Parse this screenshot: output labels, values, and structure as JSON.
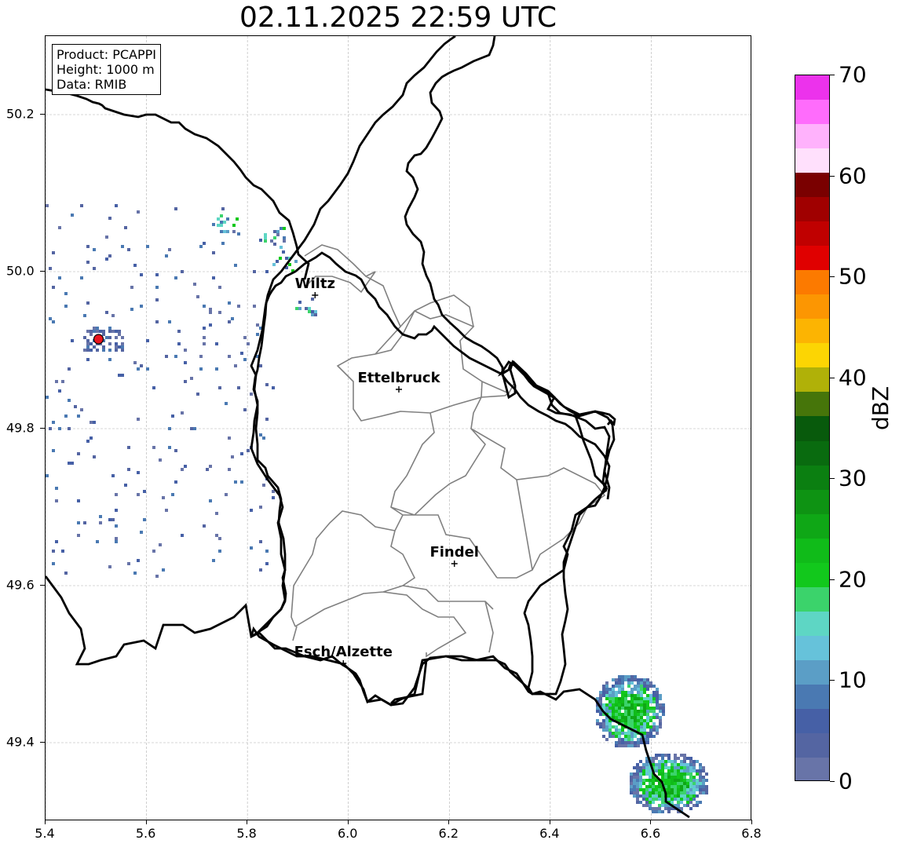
{
  "title": "02.11.2025 22:59 UTC",
  "info": {
    "product": "Product: PCAPPI",
    "height": "Height: 1000 m",
    "data": "Data: RMIB"
  },
  "map": {
    "lon_range": [
      5.4,
      6.8
    ],
    "lat_range": [
      49.3,
      50.3
    ],
    "x_ticks": [
      "5.4",
      "5.6",
      "5.8",
      "6.0",
      "6.2",
      "6.4",
      "6.6",
      "6.8"
    ],
    "y_ticks": [
      "49.4",
      "49.6",
      "49.8",
      "50.0",
      "50.2"
    ],
    "grid": true,
    "radar_site": {
      "lon": 5.505,
      "lat": 49.914,
      "color": "#e8141e"
    },
    "cities": [
      {
        "name": "Wiltz",
        "lon": 5.934,
        "lat": 49.97
      },
      {
        "name": "Ettelbruck",
        "lon": 6.1,
        "lat": 49.85
      },
      {
        "name": "Findel",
        "lon": 6.21,
        "lat": 49.628
      },
      {
        "name": "Esch/Alzette",
        "lon": 5.99,
        "lat": 49.501
      }
    ]
  },
  "colorbar": {
    "label": "dBZ",
    "min": 0,
    "max": 70,
    "ticks": [
      "0",
      "10",
      "20",
      "30",
      "40",
      "50",
      "60",
      "70"
    ],
    "colors": [
      "#6874a8",
      "#5465a2",
      "#4660a6",
      "#4a79b2",
      "#5b9ec6",
      "#66c2da",
      "#5ed6c4",
      "#3bd36b",
      "#12c81c",
      "#10bb19",
      "#0fa716",
      "#0e9313",
      "#0b7f11",
      "#096b0f",
      "#085a0c",
      "#46750a",
      "#b0b108",
      "#fcd503",
      "#fcb402",
      "#fc9602",
      "#fc7a00",
      "#e00000",
      "#c00000",
      "#a00000",
      "#7a0000",
      "#ffe0fc",
      "#ffb2fc",
      "#ff6cfc",
      "#ec32ec"
    ]
  }
}
